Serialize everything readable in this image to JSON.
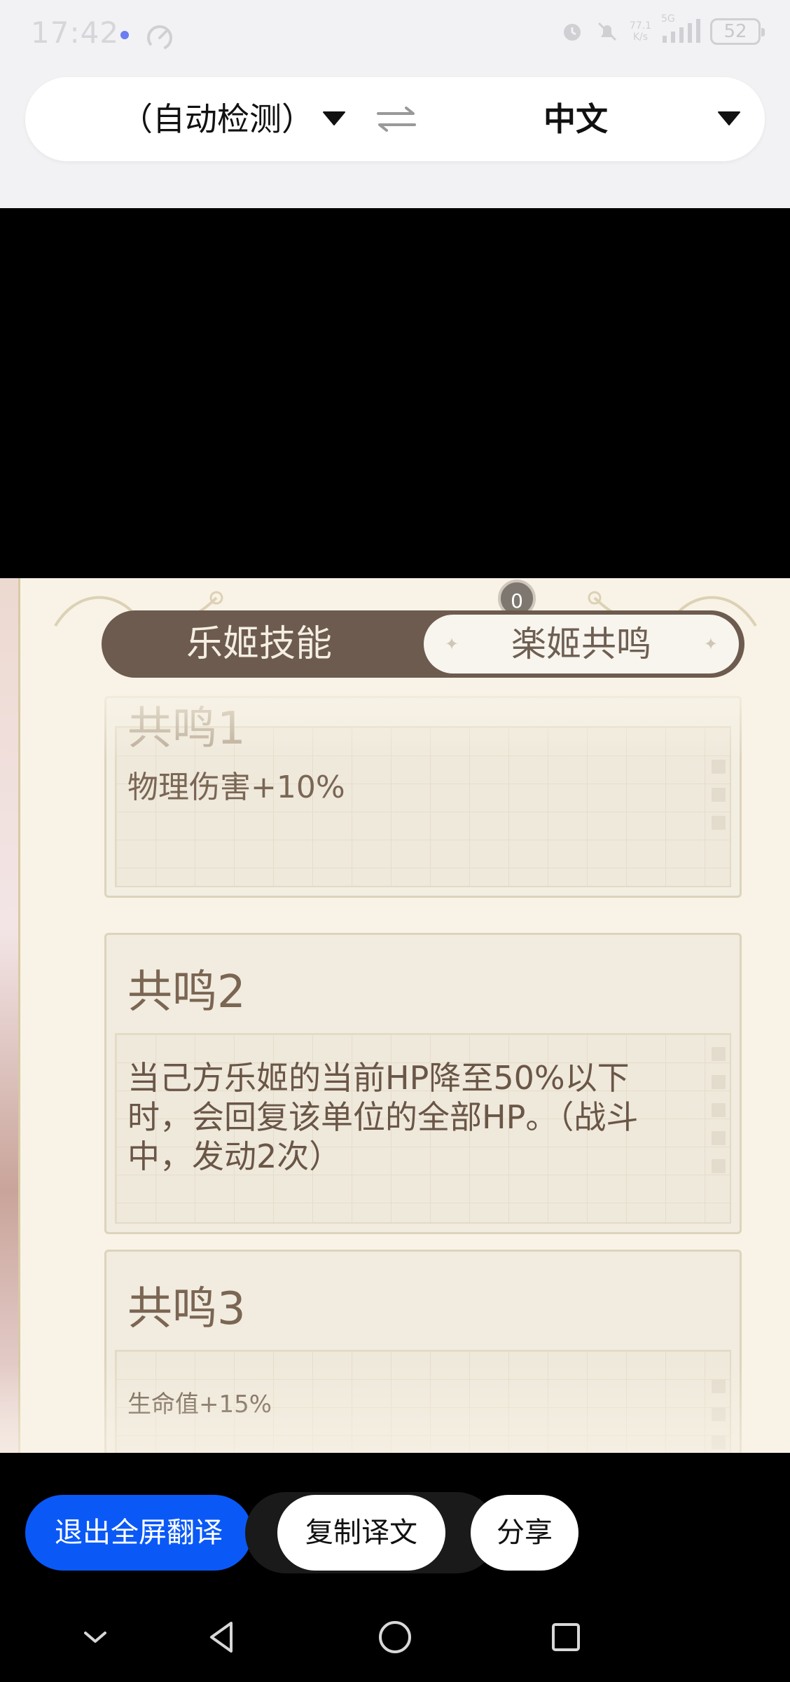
{
  "status_bar": {
    "time": "17:42",
    "net_speed_value": "77.1",
    "net_speed_unit": "K/s",
    "signal_label": "5G",
    "battery": "52"
  },
  "translator": {
    "source_language": "（自动检测）",
    "target_language": "中文"
  },
  "game": {
    "badge": "0",
    "tabs": [
      {
        "label": "乐姬技能",
        "active": true
      },
      {
        "label": "楽姬共鸣",
        "active": false
      }
    ],
    "resonances": [
      {
        "title": "共鸣1",
        "text": "物理伤害+10%"
      },
      {
        "title": "共鸣2",
        "text": "当己方乐姬的当前HP降至50%以下时，会回复该单位的全部HP。（战斗中，发动2次）"
      },
      {
        "title": "共鸣3",
        "text": "生命值+15%"
      }
    ]
  },
  "actions": {
    "exit_fullscreen": "退出全屏翻译",
    "copy_translation": "复制译文",
    "share": "分享"
  },
  "colors": {
    "accent_blue": "#0a59f7",
    "tab_dark": "#6c5b4e",
    "panel_text": "#6a5647"
  }
}
